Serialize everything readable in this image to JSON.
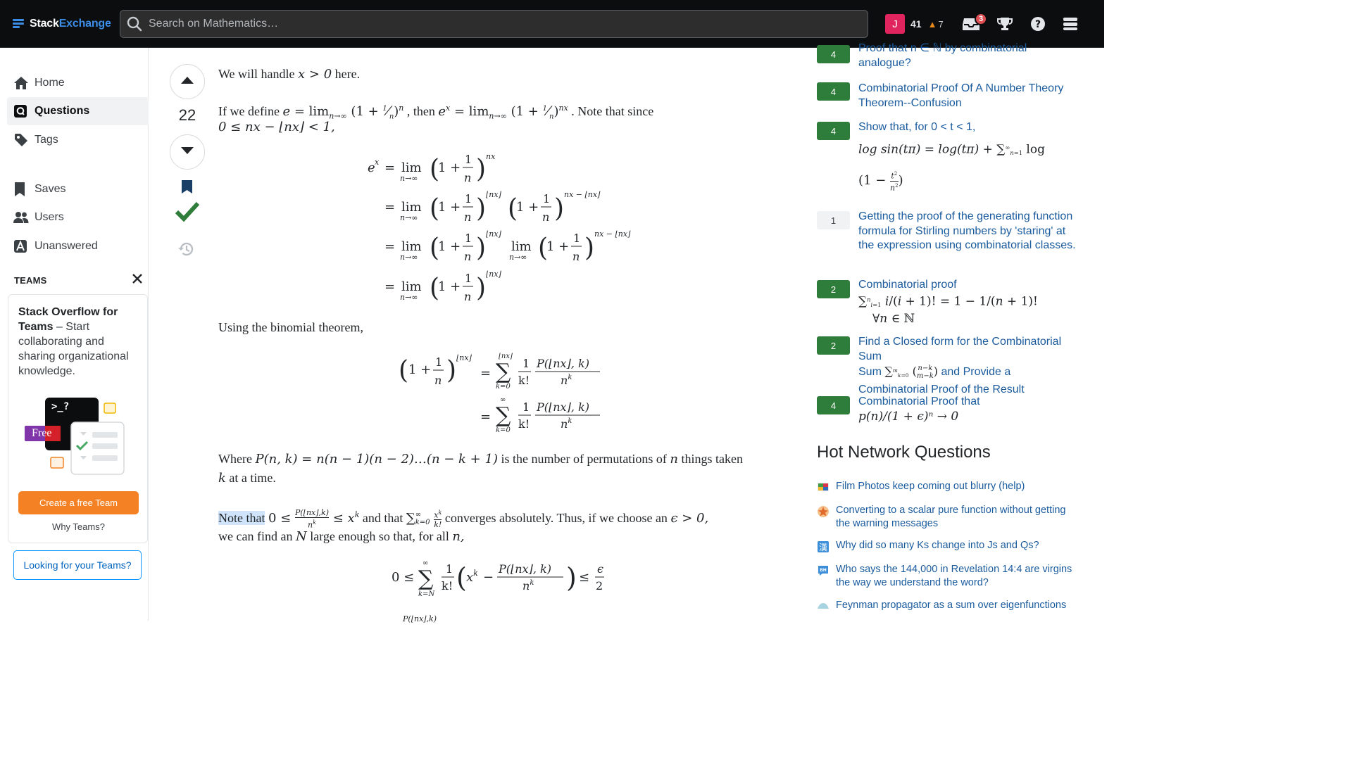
{
  "header": {
    "logo_part1": "Stack",
    "logo_part2": "Exchange",
    "search_placeholder": "Search on Mathematics…",
    "user_initial": "J",
    "reputation": "41",
    "bronze_badges": "7",
    "inbox_count": "3",
    "icons": [
      "search-icon",
      "inbox-icon",
      "achievements-icon",
      "help-icon",
      "site-switcher-icon"
    ]
  },
  "sidebar": {
    "items": [
      {
        "label": "Home",
        "icon": "home-icon"
      },
      {
        "label": "Questions",
        "icon": "questions-icon",
        "active": true
      },
      {
        "label": "Tags",
        "icon": "tag-icon"
      },
      {
        "label": "Saves",
        "icon": "bookmark-icon"
      },
      {
        "label": "Users",
        "icon": "users-icon"
      },
      {
        "label": "Unanswered",
        "icon": "unanswered-icon"
      }
    ],
    "teams_heading": "TEAMS",
    "teams_card": {
      "title": "Stack Overflow for Teams",
      "text": " – Start collaborating and sharing organizational knowledge.",
      "art_terminal": ">_?",
      "art_free_tag": "Free",
      "create_button": "Create a free Team",
      "why_link": "Why Teams?"
    },
    "looking_button": "Looking for your Teams?"
  },
  "vote": {
    "score": "22"
  },
  "answer": {
    "p1_a": "We will handle ",
    "p1_math": "x > 0",
    "p1_b": " here.",
    "p2_a": "If we define ",
    "p2_b": ", then ",
    "p2_c": ". Note that since",
    "p3": "0 ≤ nx − ⌊nx⌋ < 1,",
    "p4": "Using the binomial theorem,",
    "p5_a": "Where ",
    "p5_math": "P(n, k) = n(n − 1)(n − 2)…(n − k + 1)",
    "p5_b": " is the number of permutations of ",
    "p5_n": "n",
    "p5_c": " things taken",
    "p6_k": "k",
    "p6_rest": " at a time.",
    "p7_hl": "Note that",
    "p7_b": " and that ",
    "p7_c": " converges absolutely. Thus, if we choose an ",
    "p7_eps": "ϵ > 0,",
    "p8_a": "we can find an ",
    "p8_N": "N",
    "p8_b": " large enough so that, for all ",
    "p8_n": "n,"
  },
  "related": [
    {
      "count": "4",
      "color": "green",
      "title": "Proof that n ∈ ℕ by combinatorial analogue?"
    },
    {
      "count": "4",
      "color": "green",
      "title": "Combinatorial Proof Of A Number Theory Theorem--Confusion"
    },
    {
      "count": "4",
      "color": "green",
      "title": "Show that, for 0 < t < 1,"
    },
    {
      "count": "1",
      "color": "gray",
      "title": "Getting the proof of the generating function formula for Stirling numbers by 'staring' at the expression using combinatorial classes."
    },
    {
      "count": "2",
      "color": "green",
      "title": "Combinatorial proof"
    },
    {
      "count": "2",
      "color": "green",
      "title": "Find a Closed form for the Combinatorial Sum"
    },
    {
      "count": "4",
      "color": "green",
      "title": "Combinatorial Proof that"
    }
  ],
  "related_extra": {
    "r6_mid": " and Provide a Combinatorial Proof of the Result",
    "r6_sum": "Sum",
    "r7_math": "p(n)/(1 + ϵ)ⁿ → 0"
  },
  "hot_network": {
    "title": "Hot Network Questions",
    "items": [
      {
        "title": "Film Photos keep coming out blurry (help)",
        "icon": "photography-site-icon"
      },
      {
        "title": "Converting to a scalar pure function without getting the warning messages",
        "icon": "mathematica-site-icon"
      },
      {
        "title": "Why did so many Ks change into Js and Qs?",
        "icon": "chinese-site-icon"
      },
      {
        "title": "Who says the 144,000 in Revelation 14:4 are virgins the way we understand the word?",
        "icon": "hermeneutics-site-icon"
      },
      {
        "title": "Feynman propagator as a sum over eigenfunctions",
        "icon": "physics-site-icon"
      }
    ]
  },
  "colors": {
    "topbar": "#0c0d0e",
    "brand_blue": "#3b8ee8",
    "accepted_green": "#2f7d3a",
    "link": "#1a5b9e",
    "orange": "#f48225"
  }
}
